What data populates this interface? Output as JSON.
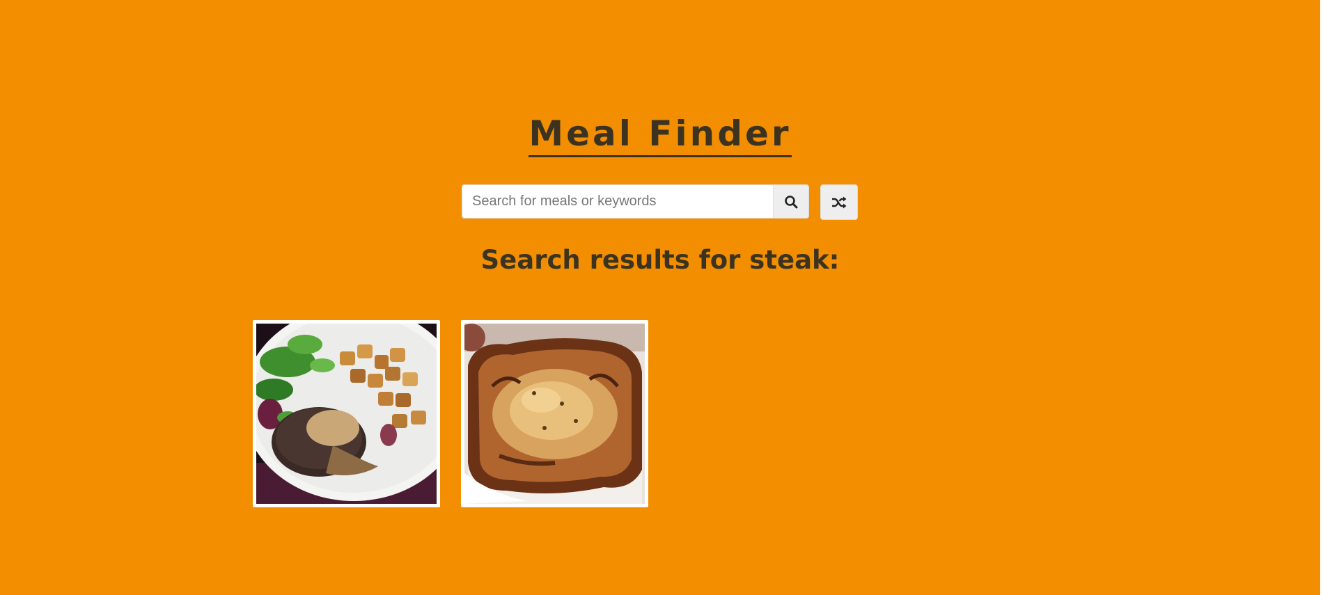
{
  "app": {
    "title": "Meal Finder"
  },
  "search": {
    "placeholder": "Search for meals or keywords",
    "value": "",
    "search_button_icon": "search-icon",
    "random_button_icon": "shuffle-icon"
  },
  "results": {
    "heading": "Search results for steak:",
    "meals": [
      {
        "icon": "steak-meal-image"
      },
      {
        "icon": "steak-pie-meal-image"
      }
    ]
  },
  "colors": {
    "background": "#f28e00",
    "text": "#3b3320",
    "button_bg": "#eeeeee",
    "card_border": "#ffffff"
  }
}
